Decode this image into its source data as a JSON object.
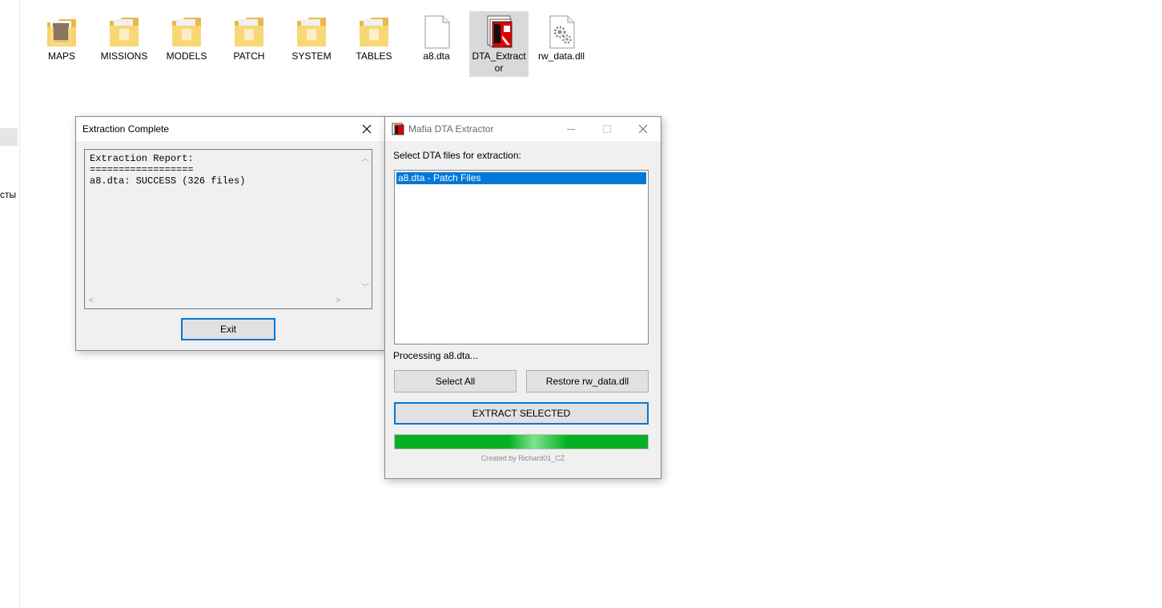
{
  "nav": {
    "partial_label": "сты"
  },
  "desktop_files": [
    {
      "label": "MAPS",
      "icon": "folder-icon"
    },
    {
      "label": "MISSIONS",
      "icon": "folder-icon"
    },
    {
      "label": "MODELS",
      "icon": "folder-icon"
    },
    {
      "label": "PATCH",
      "icon": "folder-icon"
    },
    {
      "label": "SYSTEM",
      "icon": "folder-icon"
    },
    {
      "label": "TABLES",
      "icon": "folder-icon"
    },
    {
      "label": "a8.dta",
      "icon": "blank-file-icon"
    },
    {
      "label": "DTA_Extract\nor",
      "icon": "app-icon"
    },
    {
      "label": "rw_data.dll",
      "icon": "dll-file-icon"
    }
  ],
  "report_window": {
    "title": "Extraction Complete",
    "report_text": "Extraction Report:\n==================\na8.dta: SUCCESS (326 files)",
    "exit_label": "Exit"
  },
  "extractor_window": {
    "title": "Mafia DTA Extractor",
    "instruction": "Select DTA files for extraction:",
    "list_items": [
      "a8.dta - Patch Files"
    ],
    "status": "Processing a8.dta...",
    "select_all_label": "Select All",
    "restore_label": "Restore rw_data.dll",
    "extract_label": "EXTRACT SELECTED",
    "progress": 1.0,
    "credit": "Created by Richard01_CZ"
  },
  "colors": {
    "selection": "#0078d7",
    "progress": "#06b025",
    "folder": "#f8d775"
  }
}
